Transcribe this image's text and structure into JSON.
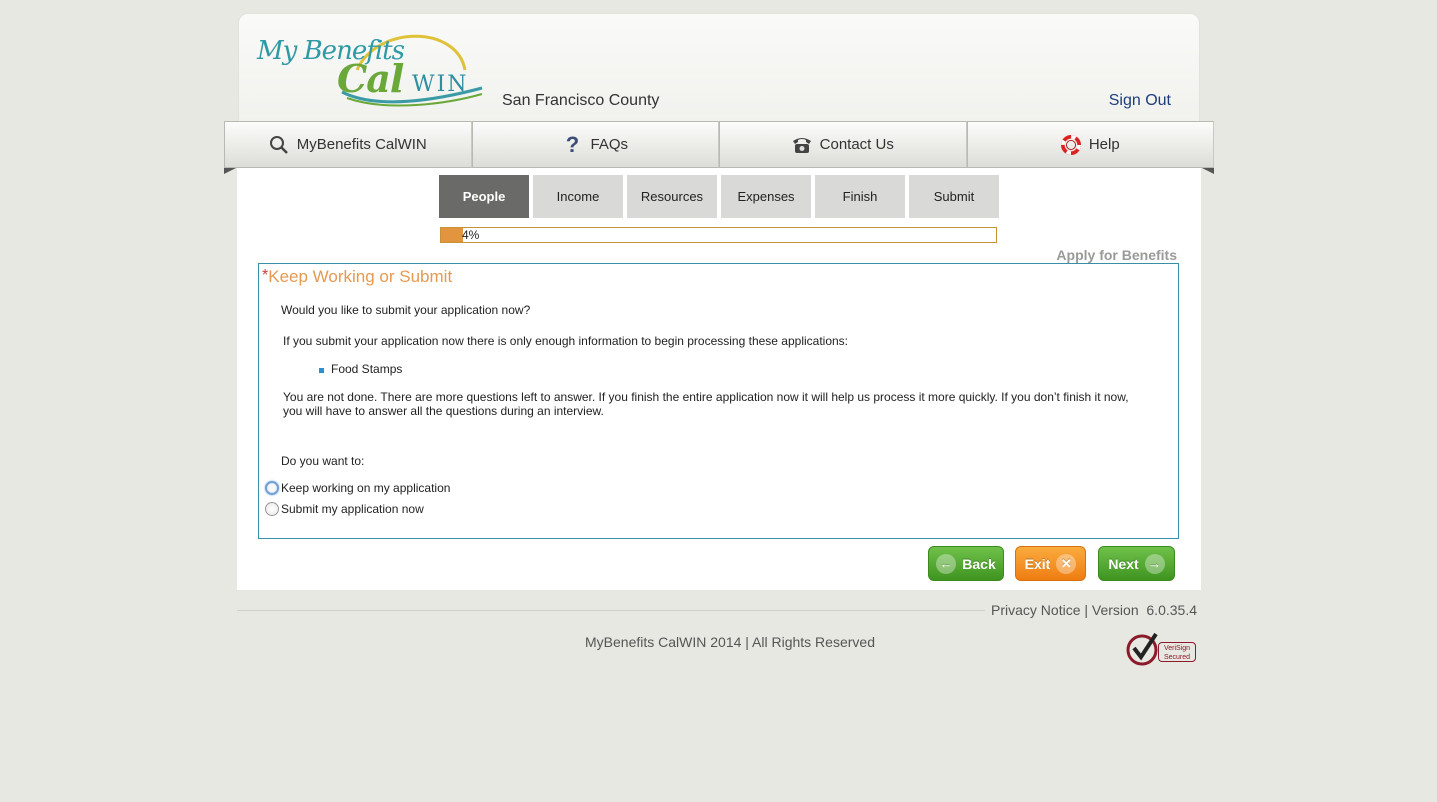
{
  "header": {
    "logo_text_my": "My Benefits",
    "logo_text_cal": "Cal",
    "logo_text_win": "WIN",
    "county": "San Francisco County",
    "sign_out": "Sign Out"
  },
  "nav": {
    "items": [
      {
        "label": "MyBenefits CalWIN",
        "icon": "search-icon"
      },
      {
        "label": "FAQs",
        "icon": "question-icon"
      },
      {
        "label": "Contact Us",
        "icon": "phone-icon"
      },
      {
        "label": "Help",
        "icon": "lifebuoy-icon"
      }
    ]
  },
  "steps": {
    "items": [
      "People",
      "Income",
      "Resources",
      "Expenses",
      "Finish",
      "Submit"
    ],
    "active": "People"
  },
  "progress": {
    "percent": 4,
    "label": "4%"
  },
  "page_title": "Apply for Benefits",
  "section": {
    "required_marker": "*",
    "title": "Keep Working or Submit",
    "question": "Would you like to submit your application now?",
    "info": "If you submit your application now there is only enough information to begin processing these applications:",
    "programs": [
      "Food Stamps"
    ],
    "note_line1": "You are not done. There are more questions left to answer. If you finish the entire application now it will help us process it more quickly. If you don’t finish it now,",
    "note_line2": "you will have to answer all the questions during an interview.",
    "prompt": "Do you want to:",
    "options": [
      {
        "label": "Keep working on my application",
        "selected": false,
        "focused": true
      },
      {
        "label": "Submit my application now",
        "selected": false,
        "focused": false
      }
    ]
  },
  "buttons": {
    "back": "Back",
    "exit": "Exit",
    "next": "Next"
  },
  "footer": {
    "privacy": "Privacy Notice",
    "separator": "|",
    "version_label": "Version",
    "version": "6.0.35.4",
    "copyright": "MyBenefits CalWIN 2014 | All Rights Reserved",
    "seal_line1": "VeriSign",
    "seal_line2": "Secured"
  },
  "colors": {
    "accent_orange": "#e59a52",
    "progress_fill": "#e2953e",
    "box_border": "#3a8fa8",
    "button_green": "#4fa52c",
    "button_orange": "#f38d1e",
    "link_blue": "#1f3d7a"
  }
}
